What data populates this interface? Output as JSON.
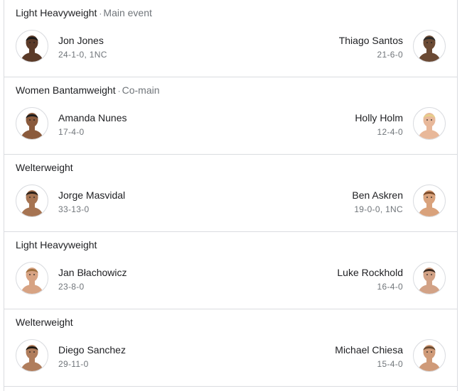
{
  "fights": [
    {
      "weight_class": "Light Heavyweight",
      "note": "Main event",
      "left": {
        "name": "Jon Jones",
        "record": "24-1-0, 1NC",
        "skin": "#5b3a28",
        "hair": "#1a1a1a"
      },
      "right": {
        "name": "Thiago Santos",
        "record": "21-6-0",
        "skin": "#6b4a34",
        "hair": "#2a2a2a"
      }
    },
    {
      "weight_class": "Women Bantamweight",
      "note": "Co-main",
      "left": {
        "name": "Amanda Nunes",
        "record": "17-4-0",
        "skin": "#8a5a3c",
        "hair": "#1c1c1c"
      },
      "right": {
        "name": "Holly Holm",
        "record": "12-4-0",
        "skin": "#e8b89a",
        "hair": "#e6cf8a"
      }
    },
    {
      "weight_class": "Welterweight",
      "note": "",
      "left": {
        "name": "Jorge Masvidal",
        "record": "33-13-0",
        "skin": "#a67452",
        "hair": "#2b2018"
      },
      "right": {
        "name": "Ben Askren",
        "record": "19-0-0, 1NC",
        "skin": "#d9a27c",
        "hair": "#7a4a28"
      }
    },
    {
      "weight_class": "Light Heavyweight",
      "note": "",
      "left": {
        "name": "Jan Błachowicz",
        "record": "23-8-0",
        "skin": "#d7a383",
        "hair": "#a07040"
      },
      "right": {
        "name": "Luke Rockhold",
        "record": "16-4-0",
        "skin": "#d2a286",
        "hair": "#3a2a20"
      }
    },
    {
      "weight_class": "Welterweight",
      "note": "",
      "left": {
        "name": "Diego Sanchez",
        "record": "29-11-0",
        "skin": "#b07d5c",
        "hair": "#1e1812"
      },
      "right": {
        "name": "Michael Chiesa",
        "record": "15-4-0",
        "skin": "#cf9a78",
        "hair": "#6a4a30"
      }
    }
  ]
}
